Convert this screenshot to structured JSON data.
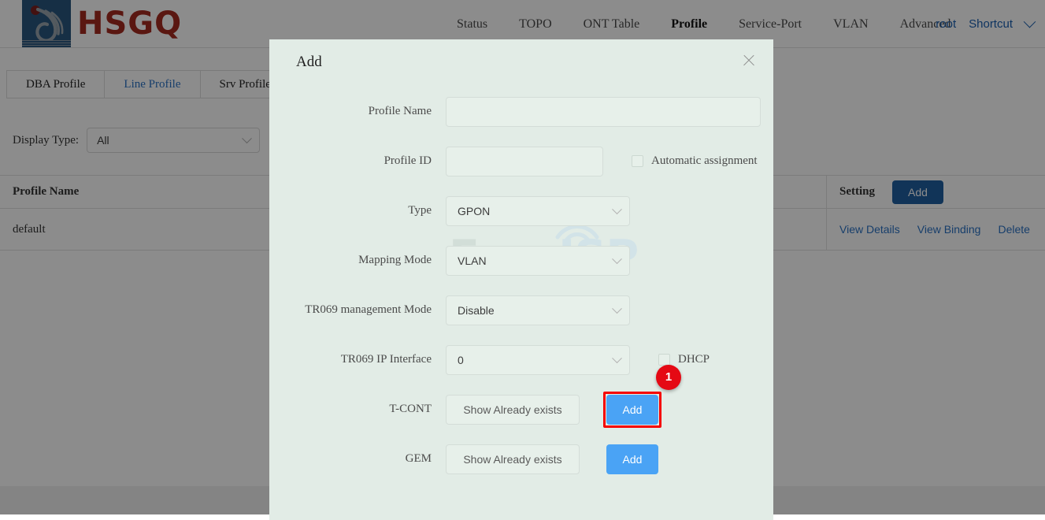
{
  "brand": {
    "name": "HSGQ",
    "logo_icon": "hsgq-flame-logo-icon",
    "accent_color": "#a52a1f",
    "logo_bg_color": "#28567f"
  },
  "nav": {
    "items": [
      {
        "label": "Status",
        "active": false
      },
      {
        "label": "TOPO",
        "active": false
      },
      {
        "label": "ONT Table",
        "active": false
      },
      {
        "label": "Profile",
        "active": true
      },
      {
        "label": "Service-Port",
        "active": false
      },
      {
        "label": "VLAN",
        "active": false
      },
      {
        "label": "Advanced",
        "active": false
      }
    ],
    "user": "root",
    "shortcut": "Shortcut",
    "shortcut_icon": "chevron-down-icon",
    "link_color": "#1b5fb0"
  },
  "tabs": [
    {
      "label": "DBA Profile",
      "active": false
    },
    {
      "label": "Line Profile",
      "active": true
    },
    {
      "label": "Srv Profile",
      "active": false
    }
  ],
  "filter": {
    "label": "Display Type:",
    "value": "All",
    "icon": "chevron-down-icon"
  },
  "table": {
    "columns": [
      "Profile Name",
      "",
      "Setting"
    ],
    "header_add_label": "Add",
    "rows": [
      {
        "profile_name": "default",
        "actions": [
          "View Details",
          "View Binding",
          "Delete"
        ]
      }
    ]
  },
  "modal": {
    "title": "Add",
    "close_icon": "close-icon",
    "bg_color": "#e2ece6",
    "fields": {
      "profile_name": {
        "label": "Profile Name",
        "value": "",
        "placeholder": ""
      },
      "profile_id": {
        "label": "Profile ID",
        "value": "",
        "placeholder": ""
      },
      "automatic_assignment": {
        "label": "Automatic assignment",
        "checked": false
      },
      "type": {
        "label": "Type",
        "value": "GPON",
        "icon": "chevron-down-icon"
      },
      "mapping_mode": {
        "label": "Mapping Mode",
        "value": "VLAN",
        "icon": "chevron-down-icon"
      },
      "tr069_management_mode": {
        "label": "TR069 management Mode",
        "value": "Disable",
        "icon": "chevron-down-icon"
      },
      "tr069_ip_interface": {
        "label": "TR069 IP Interface",
        "value": "0",
        "icon": "chevron-down-icon"
      },
      "dhcp": {
        "label": "DHCP",
        "checked": false
      },
      "tcont": {
        "label": "T-CONT",
        "show_label": "Show Already exists",
        "add_label": "Add",
        "highlighted": true,
        "highlight_color": "#f50000",
        "badge": "1",
        "badge_color": "#e50914"
      },
      "gem": {
        "label": "GEM",
        "show_label": "Show Already exists",
        "add_label": "Add"
      }
    },
    "button_color": "#4aa3f5"
  },
  "watermark": {
    "part1": "Foro",
    "part2": "ISP",
    "icon": "wifi-signal-icon",
    "color1": "#c6d4cd",
    "color2": "#c5dcea"
  }
}
